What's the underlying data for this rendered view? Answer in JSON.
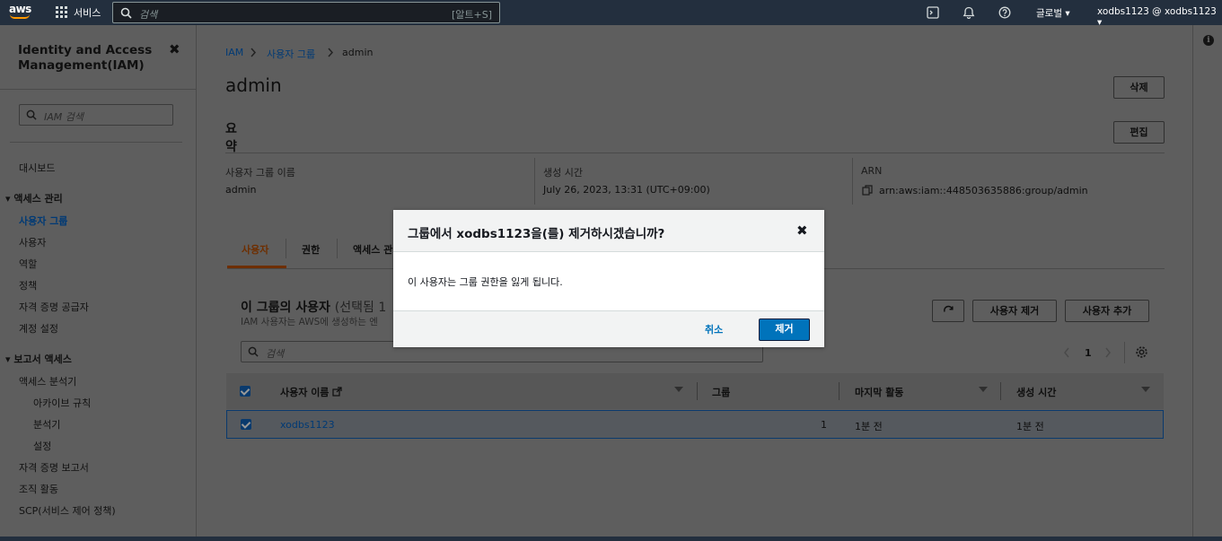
{
  "topnav": {
    "logo": "aws",
    "services": "서비스",
    "search_placeholder": "검색",
    "search_shortcut": "[알트+S]",
    "region": "글로벌 ▾",
    "account": "xodbs1123 @ xodbs1123 ▾"
  },
  "sidebar": {
    "title": "Identity and Access Management(IAM)",
    "close": "✖",
    "search_placeholder": "IAM 검색",
    "dashboard": "대시보드",
    "access_mgmt": {
      "label": "액세스 관리",
      "items": [
        "사용자 그룹",
        "사용자",
        "역할",
        "정책",
        "자격 증명 공급자",
        "계정 설정"
      ]
    },
    "access_report": {
      "label": "보고서 액세스",
      "analyzer": "액세스 분석기",
      "sub_items": [
        "아카이브 규칙",
        "분석기",
        "설정"
      ],
      "items": [
        "자격 증명 보고서",
        "조직 활동",
        "SCP(서비스 제어 정책)"
      ]
    }
  },
  "breadcrumb": {
    "root": "IAM",
    "groups": "사용자 그룹",
    "current": "admin"
  },
  "page": {
    "title": "admin",
    "delete_button": "삭제",
    "summary_title": "요약",
    "edit_button": "편집",
    "summary": {
      "group_name_label": "사용자 그룹 이름",
      "group_name": "admin",
      "created_label": "생성 시간",
      "created": "July 26, 2023, 13:31 (UTC+09:00)",
      "arn_label": "ARN",
      "arn": "arn:aws:iam::448503635886:group/admin"
    },
    "tabs": [
      "사용자",
      "권한",
      "액세스 관"
    ]
  },
  "users_panel": {
    "title": "이 그룹의 사용자",
    "count": "(선택됨 1",
    "subtitle": "IAM 사용자는 AWS에 생성하는 엔",
    "remove_user_button": "사용자 제거",
    "add_user_button": "사용자 추가",
    "search_placeholder": "검색",
    "page_number": "1",
    "columns": [
      "사용자 이름",
      "그룹",
      "마지막 활동",
      "생성 시간"
    ],
    "rows": [
      {
        "name": "xodbs1123",
        "groups": "1",
        "last_activity": "1분 전",
        "created": "1분 전"
      }
    ]
  },
  "modal": {
    "title": "그룹에서 xodbs1123을(를) 제거하시겠습니까?",
    "close": "✖",
    "body": "이 사용자는 그룹 권한을 잃게 됩니다.",
    "cancel": "취소",
    "confirm": "제거"
  },
  "colors": {
    "nav_bg": "#232f3e",
    "primary": "#0073bb",
    "accent_orange": "#ff9900",
    "link": "#0073bb"
  }
}
